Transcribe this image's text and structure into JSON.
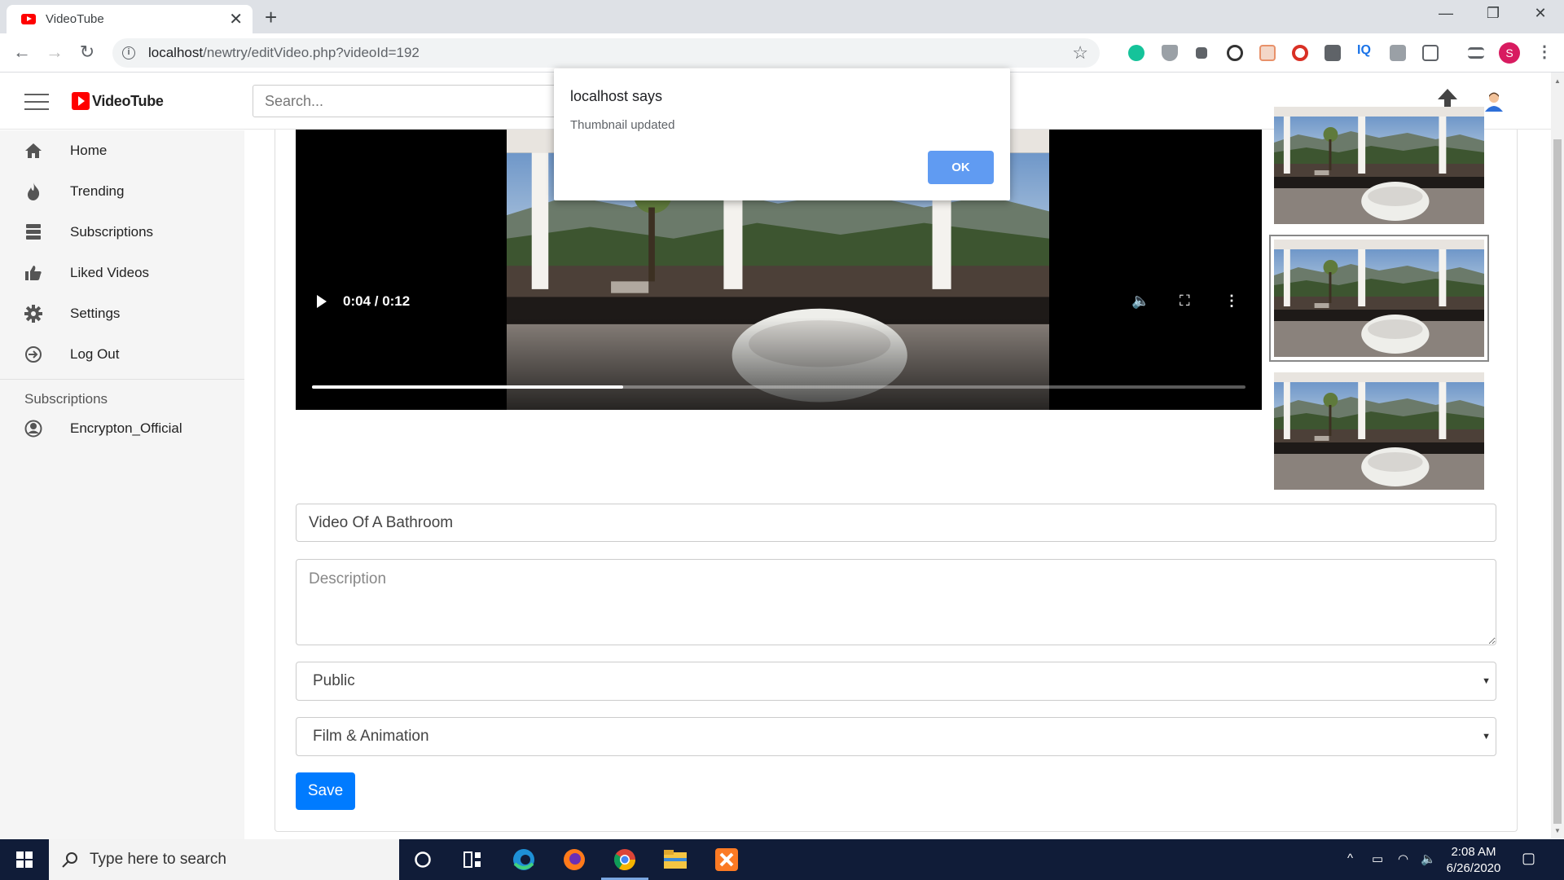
{
  "browser": {
    "tab_title": "VideoTube",
    "url_host": "localhost",
    "url_path": "/newtry/editVideo.php?videoId=192",
    "profile_initial": "S"
  },
  "header": {
    "logo_text": "VideoTube",
    "search_placeholder": "Search..."
  },
  "sidebar": {
    "items": [
      {
        "label": "Home",
        "icon": "home-icon"
      },
      {
        "label": "Trending",
        "icon": "flame-icon"
      },
      {
        "label": "Subscriptions",
        "icon": "subscriptions-icon"
      },
      {
        "label": "Liked Videos",
        "icon": "thumbs-up-icon"
      },
      {
        "label": "Settings",
        "icon": "gear-icon"
      },
      {
        "label": "Log Out",
        "icon": "logout-icon"
      }
    ],
    "subscriptions_heading": "Subscriptions",
    "subscriptions": [
      {
        "label": "Encrypton_Official",
        "icon": "user-circle-icon"
      }
    ]
  },
  "video": {
    "time": "0:04 / 0:12",
    "progress": 0.333
  },
  "thumbnails": {
    "count": 3,
    "selected_index": 1
  },
  "form": {
    "title_value": "Video Of A Bathroom",
    "description_placeholder": "Description",
    "privacy_value": "Public",
    "category_value": "Film & Animation",
    "save_label": "Save"
  },
  "dialog": {
    "title": "localhost says",
    "message": "Thumbnail updated",
    "ok_label": "OK"
  },
  "taskbar": {
    "search_placeholder": "Type here to search",
    "time": "2:08 AM",
    "date": "6/26/2020"
  },
  "colors": {
    "brand": "#ff0000",
    "save_button": "#007bff",
    "dialog_ok": "#609bf2",
    "taskbar": "#101c38"
  }
}
